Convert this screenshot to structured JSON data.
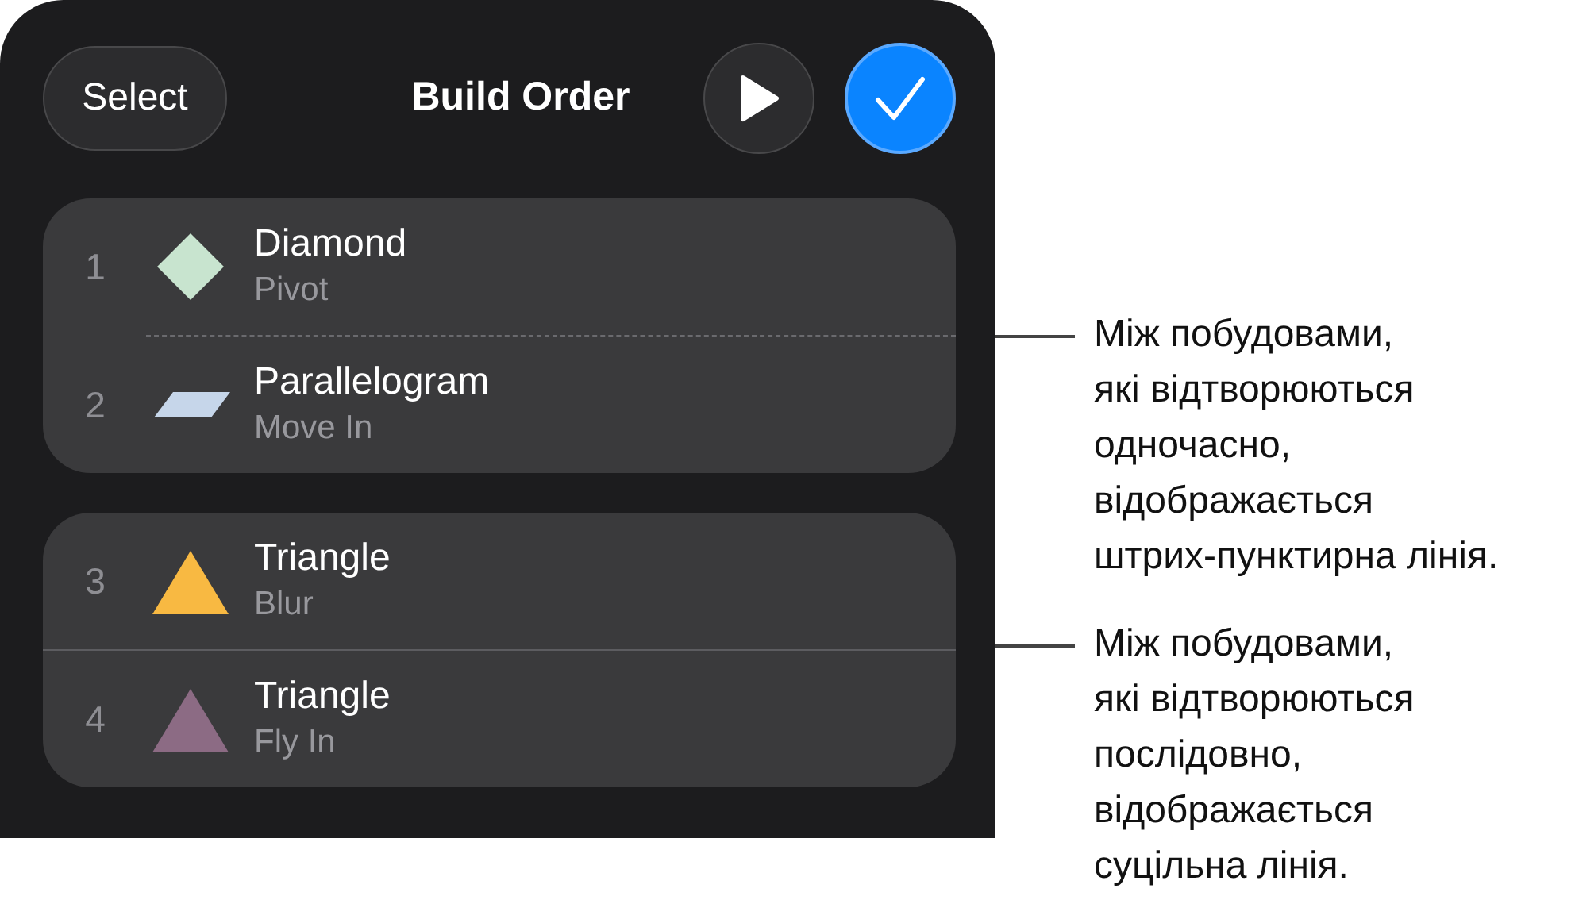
{
  "header": {
    "select_button": "Select",
    "title": "Build Order"
  },
  "groups": [
    {
      "dashed_divider": true,
      "builds": [
        {
          "number": "1",
          "kind": "diamond",
          "color": "#c8e4cf",
          "name": "Diamond",
          "effect": "Pivot"
        },
        {
          "number": "2",
          "kind": "parallelogram",
          "color": "#c6d6ea",
          "name": "Parallelogram",
          "effect": "Move In"
        }
      ]
    },
    {
      "dashed_divider": false,
      "builds": [
        {
          "number": "3",
          "kind": "triangle",
          "color": "#f8b942",
          "name": "Triangle",
          "effect": "Blur"
        },
        {
          "number": "4",
          "kind": "triangle",
          "color": "#8c6b84",
          "name": "Triangle",
          "effect": "Fly In"
        }
      ]
    }
  ],
  "callouts": [
    {
      "lines": [
        "Між побудовами,",
        "які відтворюються",
        "одночасно,",
        "відображається",
        "штрих-пунктирна лінія."
      ]
    },
    {
      "lines": [
        "Між побудовами,",
        "які відтворюються",
        "послідовно,",
        "відображається",
        "суцільна лінія."
      ]
    }
  ]
}
